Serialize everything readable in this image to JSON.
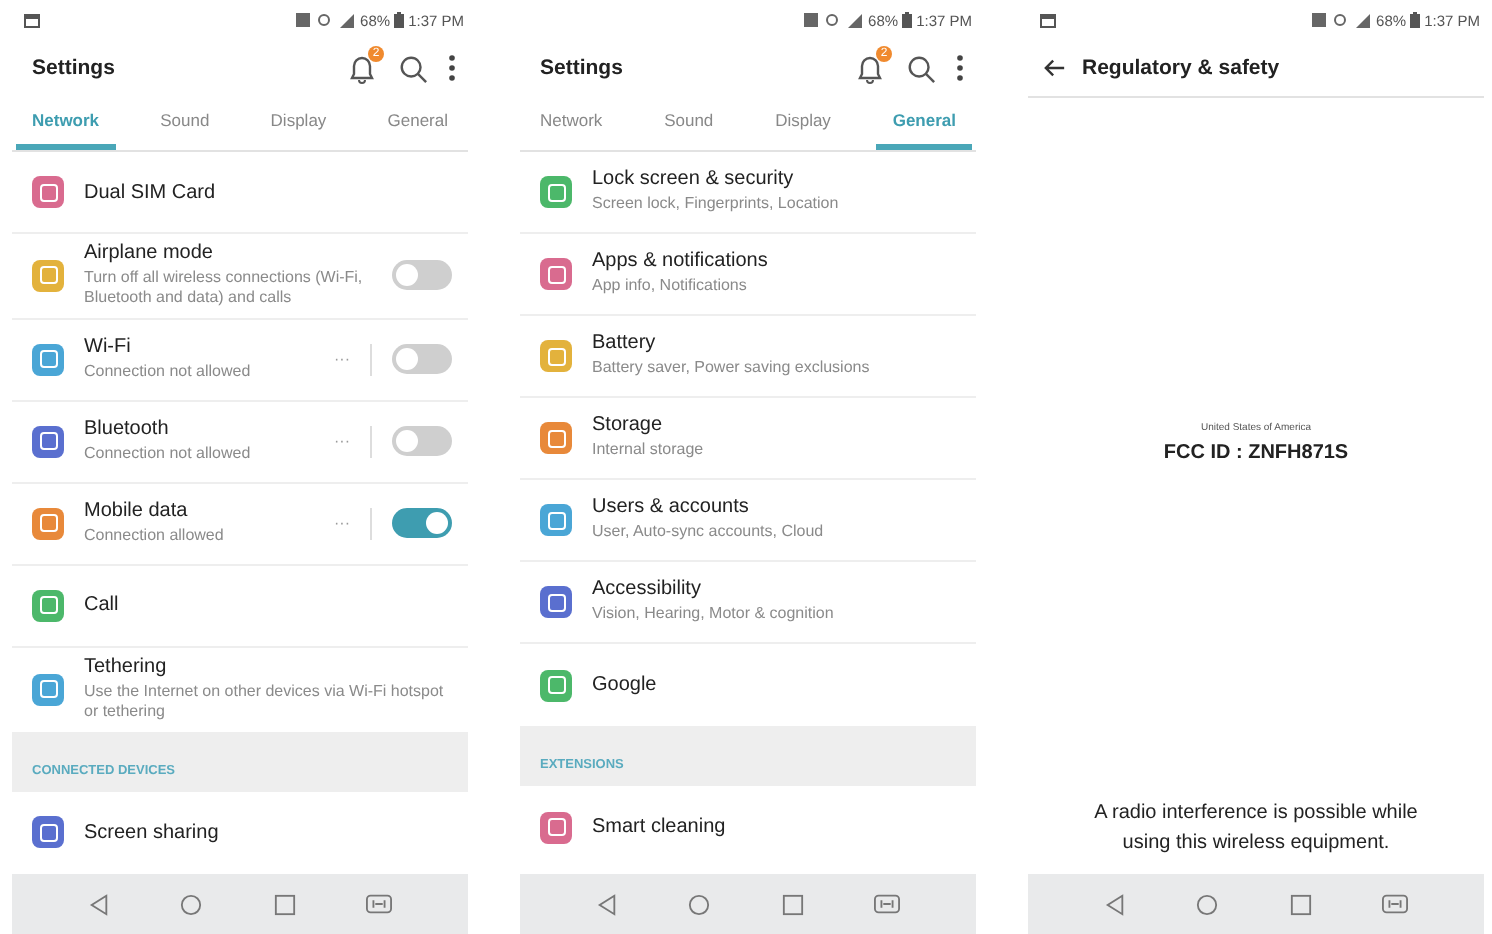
{
  "phones": [
    {
      "kind": "settings",
      "status": {
        "notification_icon": true,
        "battery": "68%",
        "time": "1:37 PM"
      },
      "title": "Settings",
      "badge": "2",
      "tabs": [
        {
          "label": "Network",
          "selected": true
        },
        {
          "label": "Sound",
          "selected": false
        },
        {
          "label": "Display",
          "selected": false
        },
        {
          "label": "General",
          "selected": false
        }
      ],
      "items": [
        {
          "kind": "item",
          "title": "Dual SIM Card",
          "color": "#d96b8f"
        },
        {
          "kind": "toggle",
          "title": "Airplane mode",
          "subtitle": "Turn off all wireless connections (Wi-Fi, Bluetooth and data) and calls",
          "color": "#e3b23c",
          "on": false
        },
        {
          "kind": "toggle",
          "title": "Wi-Fi",
          "subtitle": "Connection not allowed",
          "color": "#4aa6d6",
          "on": false,
          "more": "···"
        },
        {
          "kind": "toggle",
          "title": "Bluetooth",
          "subtitle": "Connection not allowed",
          "color": "#5a6fcf",
          "on": false,
          "more": "···"
        },
        {
          "kind": "toggle",
          "title": "Mobile data",
          "subtitle": "Connection allowed",
          "color": "#e8893a",
          "on": true,
          "more": "···"
        },
        {
          "kind": "item",
          "title": "Call",
          "color": "#4cb86a"
        },
        {
          "kind": "item",
          "title": "Tethering",
          "subtitle": "Use the Internet on other devices via Wi-Fi hotspot or tethering",
          "color": "#4aa6d6"
        },
        {
          "kind": "header",
          "title": "CONNECTED DEVICES"
        },
        {
          "kind": "item",
          "title": "Screen sharing",
          "color": "#5a6fcf"
        }
      ]
    },
    {
      "kind": "settings",
      "status": {
        "notification_icon": false,
        "battery": "68%",
        "time": "1:37 PM"
      },
      "title": "Settings",
      "badge": "2",
      "tabs": [
        {
          "label": "Network",
          "selected": false
        },
        {
          "label": "Sound",
          "selected": false
        },
        {
          "label": "Display",
          "selected": false
        },
        {
          "label": "General",
          "selected": true
        }
      ],
      "items": [
        {
          "kind": "item",
          "title": "Lock screen & security",
          "subtitle": "Screen lock, Fingerprints, Location",
          "color": "#4cb86a"
        },
        {
          "kind": "item",
          "title": "Apps & notifications",
          "subtitle": "App info, Notifications",
          "color": "#d96b8f"
        },
        {
          "kind": "item",
          "title": "Battery",
          "subtitle": "Battery saver, Power saving exclusions",
          "color": "#e3b23c"
        },
        {
          "kind": "item",
          "title": "Storage",
          "subtitle": "Internal storage",
          "color": "#e8893a"
        },
        {
          "kind": "item",
          "title": "Users & accounts",
          "subtitle": "User, Auto-sync accounts, Cloud",
          "color": "#4aa6d6"
        },
        {
          "kind": "item",
          "title": "Accessibility",
          "subtitle": "Vision, Hearing, Motor & cognition",
          "color": "#5a6fcf"
        },
        {
          "kind": "item",
          "title": "Google",
          "color": "#4cb86a"
        },
        {
          "kind": "header",
          "title": "EXTENSIONS"
        },
        {
          "kind": "item",
          "title": "Smart cleaning",
          "color": "#d96b8f"
        }
      ]
    },
    {
      "kind": "detail",
      "status": {
        "notification_icon": true,
        "battery": "68%",
        "time": "1:37 PM"
      },
      "title": "Regulatory & safety",
      "country": "United States of America",
      "fcc": "FCC ID : ZNFH871S",
      "notice": "A radio interference is possible while using this wireless equipment."
    }
  ]
}
